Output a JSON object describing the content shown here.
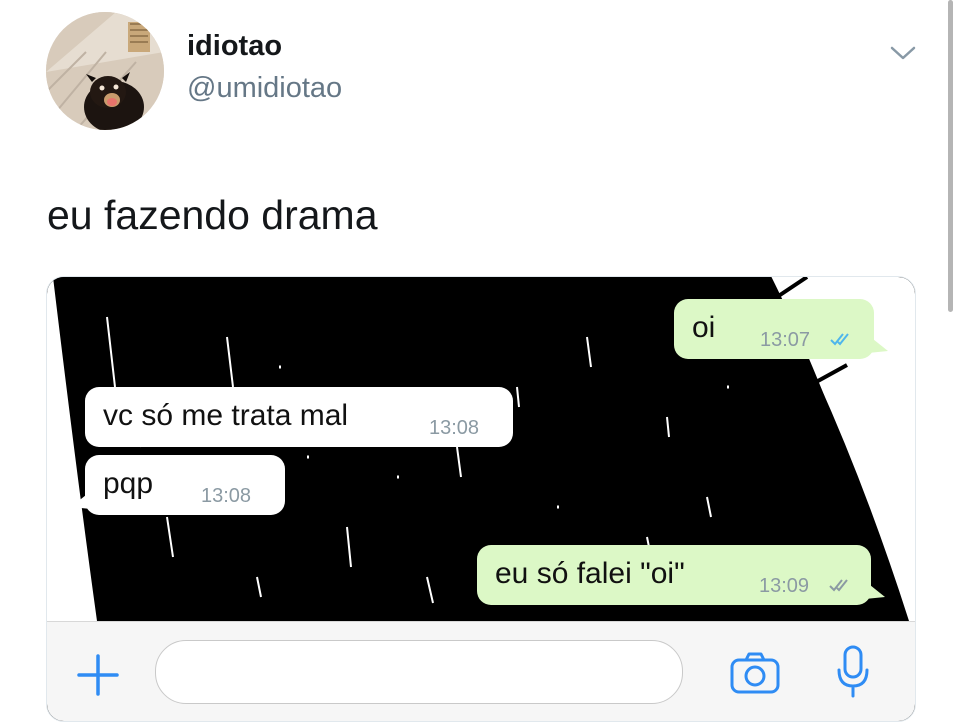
{
  "tweet": {
    "display_name": "idiotao",
    "handle": "@umidiotao",
    "text": "eu fazendo drama",
    "menu_icon": "chevron-down-icon"
  },
  "chat": {
    "messages": [
      {
        "direction": "outgoing",
        "text": "oi",
        "time": "13:07",
        "status": "read"
      },
      {
        "direction": "incoming",
        "text": "vc só me trata mal",
        "time": "13:08"
      },
      {
        "direction": "incoming",
        "text": "pqp",
        "time": "13:08"
      },
      {
        "direction": "outgoing",
        "text": "eu só falei \"oi\"",
        "time": "13:09",
        "status": "delivered"
      }
    ],
    "input_bar": {
      "icons": [
        "plus-icon",
        "camera-icon",
        "microphone-icon"
      ]
    }
  },
  "colors": {
    "accent": "#2f8cf4",
    "outgoing_bubble": "#dcf8c6",
    "incoming_bubble": "#ffffff",
    "read_ticks": "#4fb6ec",
    "delivered_ticks": "#8b9aa3",
    "handle": "#657786"
  }
}
